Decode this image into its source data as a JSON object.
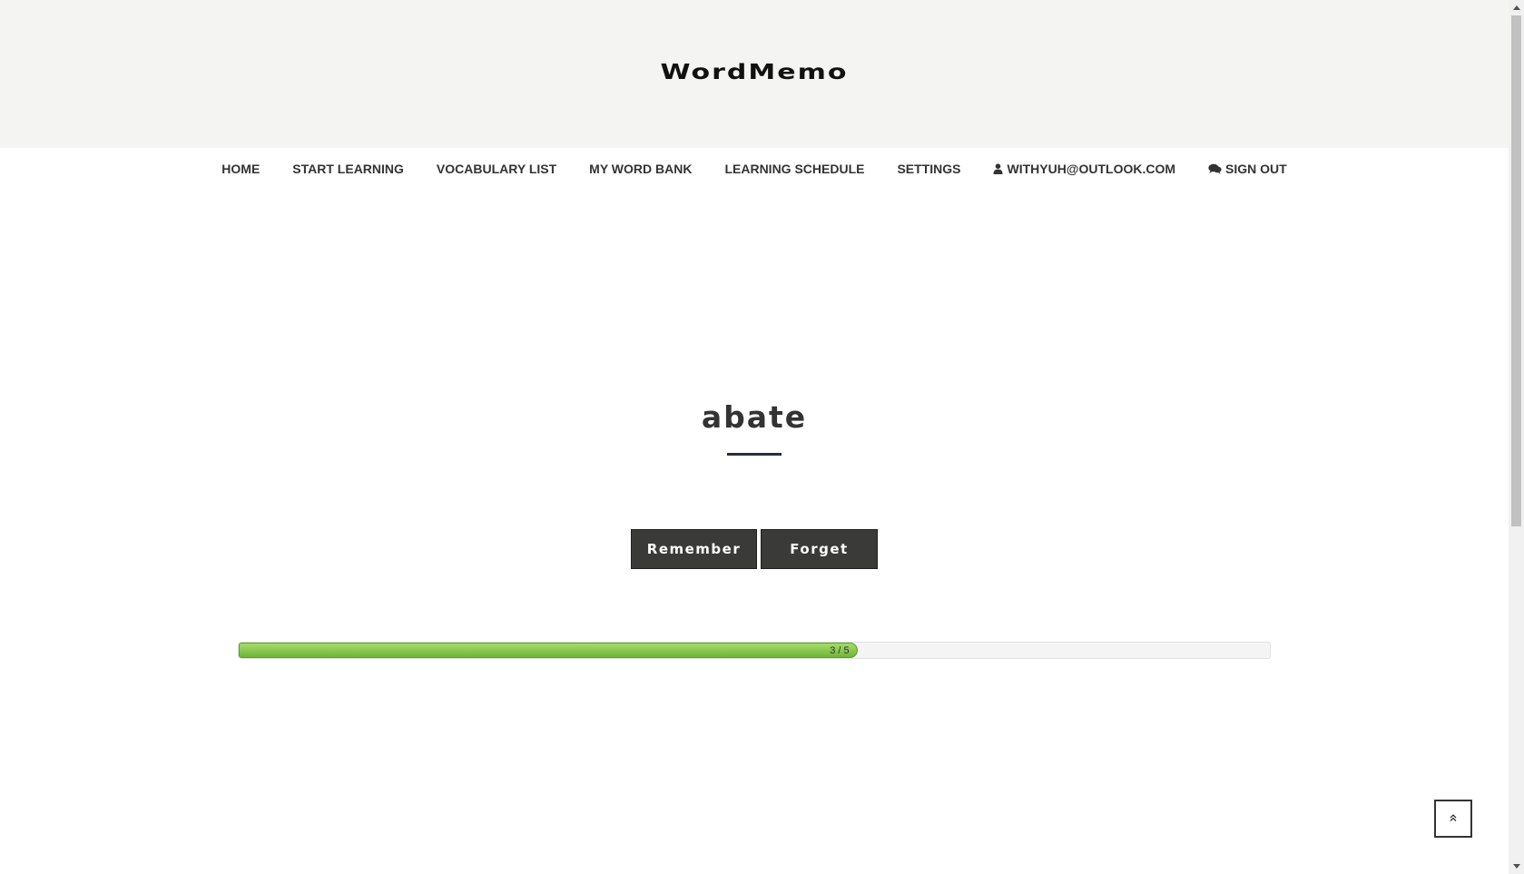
{
  "header": {
    "logo_text": "WordMemo"
  },
  "nav": {
    "items": [
      {
        "label": "HOME"
      },
      {
        "label": "START LEARNING"
      },
      {
        "label": "VOCABULARY LIST"
      },
      {
        "label": "MY WORD BANK"
      },
      {
        "label": "LEARNING SCHEDULE"
      },
      {
        "label": "SETTINGS"
      },
      {
        "label": "WITHYUH@OUTLOOK.COM",
        "icon": "user-icon"
      },
      {
        "label": "SIGN OUT",
        "icon": "comments-icon"
      }
    ]
  },
  "card": {
    "word": "abate",
    "remember_label": "Remember",
    "forget_label": "Forget"
  },
  "progress": {
    "current": 3,
    "total": 5,
    "label": "3 / 5",
    "fill_percent": 60
  },
  "colors": {
    "button_bg": "#3a3a38",
    "progress_green": "#7dc043",
    "header_bg": "#f4f4f2"
  },
  "back_to_top": {
    "icon": "double-chevron-up-icon"
  }
}
